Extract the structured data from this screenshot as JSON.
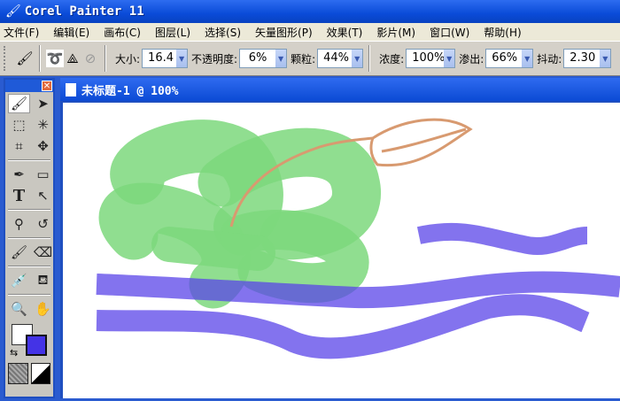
{
  "app": {
    "title": "Corel Painter 11"
  },
  "menu": [
    "文件(F)",
    "编辑(E)",
    "画布(C)",
    "图层(L)",
    "选择(S)",
    "矢量图形(P)",
    "效果(T)",
    "影片(M)",
    "窗口(W)",
    "帮助(H)"
  ],
  "toolbar": {
    "size_label": "大小:",
    "size_value": "16.4",
    "opacity_label": "不透明度:",
    "opacity_value": "6%",
    "grain_label": "颗粒:",
    "grain_value": "44%",
    "concentration_label": "浓度:",
    "concentration_value": "100%",
    "bleed_label": "渗出:",
    "bleed_value": "66%",
    "jitter_label": "抖动:",
    "jitter_value": "2.30"
  },
  "document": {
    "title": "未标题-1 @ 100%"
  },
  "colors": {
    "primary": "#ffffff",
    "secondary": "#4433e6",
    "green_stroke": "#7dd87d",
    "blue_stroke": "#5a44e8",
    "brown_stroke": "#d89a70"
  }
}
